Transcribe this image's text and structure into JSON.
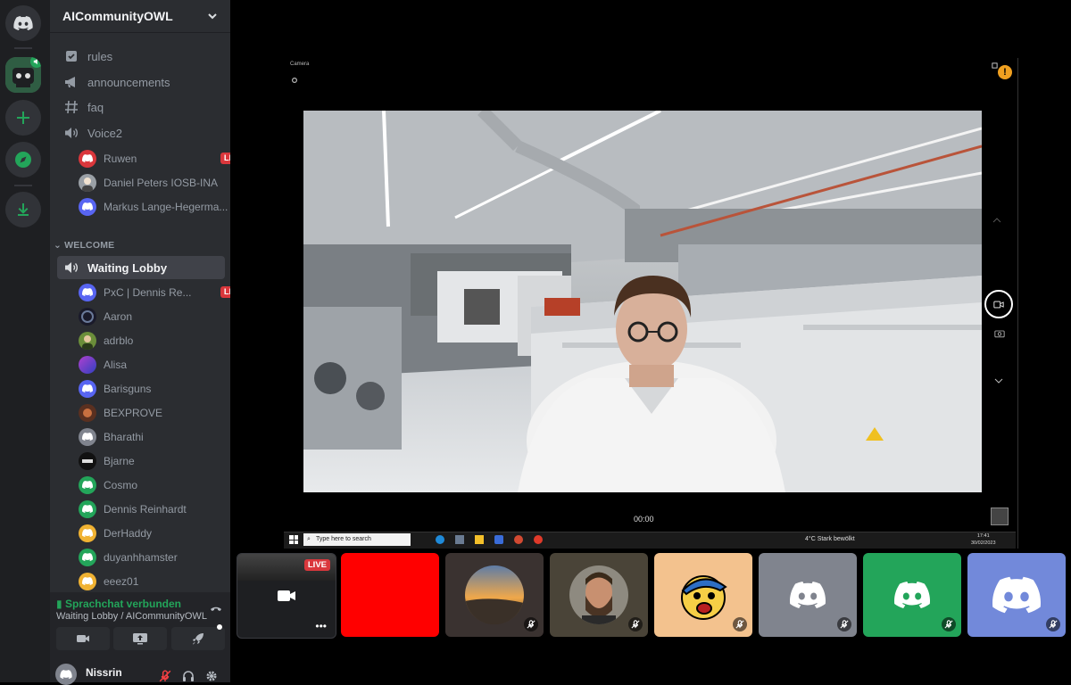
{
  "server": {
    "name": "AICommunityOWL"
  },
  "channels": [
    {
      "label": "rules"
    },
    {
      "label": "announcements"
    },
    {
      "label": "faq"
    },
    {
      "label": "Voice2"
    }
  ],
  "voice2_users": [
    {
      "name": "Ruwen",
      "live": "LIVE"
    },
    {
      "name": "Daniel Peters IOSB-INA"
    },
    {
      "name": "Markus Lange-Hegerma..."
    }
  ],
  "category": {
    "label": "WELCOME"
  },
  "waiting_lobby": {
    "label": "Waiting Lobby"
  },
  "lobby_users": [
    {
      "name": "PxC | Dennis Re...",
      "live": "LIVE"
    },
    {
      "name": "Aaron"
    },
    {
      "name": "adrblo"
    },
    {
      "name": "Alisa"
    },
    {
      "name": "Barisguns"
    },
    {
      "name": "BEXPROVE"
    },
    {
      "name": "Bharathi"
    },
    {
      "name": "Bjarne"
    },
    {
      "name": "Cosmo"
    },
    {
      "name": "Dennis Reinhardt"
    },
    {
      "name": "DerHaddy"
    },
    {
      "name": "duyanhhamster"
    },
    {
      "name": "eeez01"
    }
  ],
  "voice_status": {
    "title": "Sprachchat verbunden",
    "subtitle": "Waiting Lobby / AICommunityOWL"
  },
  "user": {
    "name": "Nissrin"
  },
  "stream": {
    "app_title": "Camera",
    "time": "00:00",
    "search_placeholder": "Type here to search",
    "weather": "4°C  Stark bewölkt",
    "clock": "17:41",
    "date": "30/02/2023"
  },
  "tiles": [
    {
      "live": "LIVE"
    }
  ],
  "colors": {
    "accent": "#5865f2",
    "live": "#da373c",
    "connected": "#23a55a"
  }
}
